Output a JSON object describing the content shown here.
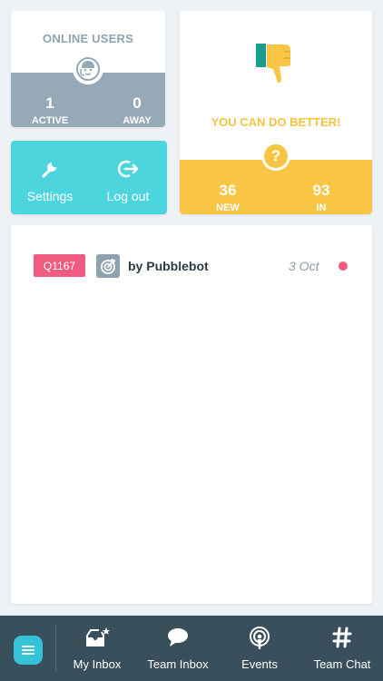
{
  "online_users": {
    "title": "ONLINE USERS",
    "active_count": "1",
    "active_label": "ACTIVE",
    "away_count": "0",
    "away_label": "AWAY"
  },
  "actions": {
    "settings_label": "Settings",
    "logout_label": "Log out"
  },
  "feedback": {
    "message": "YOU CAN DO BETTER!",
    "question_mark": "?",
    "new_count": "36",
    "new_label": "NEW",
    "in_progress_count": "93",
    "in_progress_label": "IN PROGRESS"
  },
  "tickets": [
    {
      "id": "Q1167",
      "by": "by Pubblebot",
      "date": "3 Oct",
      "icon": "target-icon"
    }
  ],
  "tabbar": {
    "items": [
      {
        "label": "My Inbox",
        "icon": "inbox-star-icon"
      },
      {
        "label": "Team Inbox",
        "icon": "chat-bubble-icon"
      },
      {
        "label": "Events",
        "icon": "broadcast-icon"
      },
      {
        "label": "Team Chat",
        "icon": "hashtag-icon"
      }
    ]
  },
  "colors": {
    "accent_teal": "#4dd5de",
    "feedback_yellow": "#f9c544",
    "users_gray": "#95a9b7",
    "ticket_pink": "#f15b80",
    "tabbar_bg": "#3a4f5c"
  }
}
